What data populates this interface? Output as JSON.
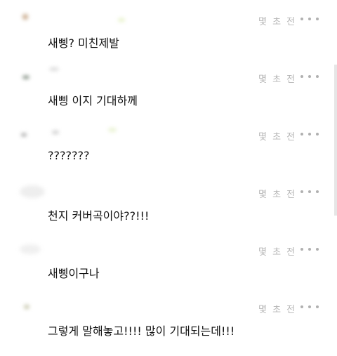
{
  "comments": [
    {
      "text": "새삥? 미친제발",
      "time": "몇 초 전"
    },
    {
      "text": "새삥 이지 기대하께",
      "time": "몇 초 전"
    },
    {
      "text": "???????",
      "time": "몇 초 전"
    },
    {
      "text": "천지 커버곡이야??!!!",
      "time": "몇 초 전"
    },
    {
      "text": "새삥이구나",
      "time": "몇 초 전"
    },
    {
      "text": "그렇게 말해놓고!!!! 많이 기대되는데!!!",
      "time": "몇 초 전"
    }
  ],
  "icons": {
    "more": "more-options-icon"
  },
  "colors": {
    "text": "#111111",
    "timestamp": "#b5b5b5",
    "dots": "#b0b0b0",
    "background": "#ffffff"
  }
}
